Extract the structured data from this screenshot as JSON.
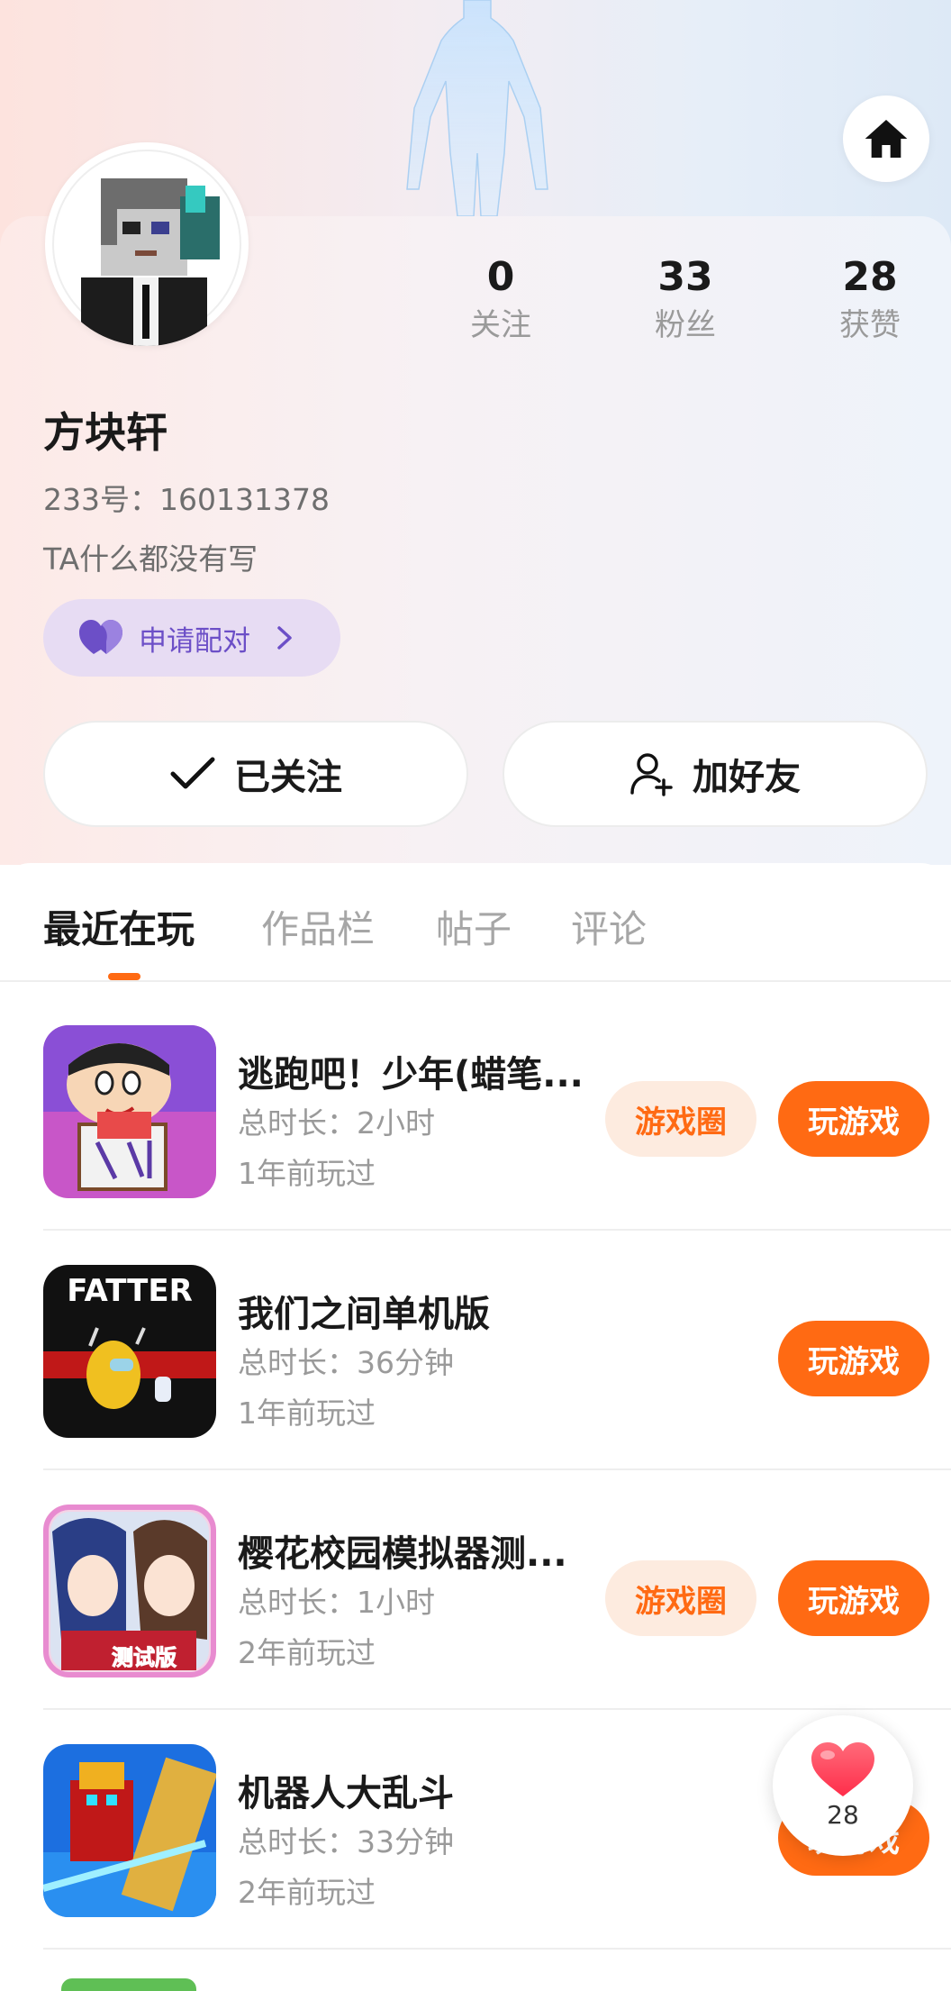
{
  "header": {
    "home_icon": "home-icon"
  },
  "profile": {
    "name": "方块轩",
    "id_text": "233号：160131378",
    "bio": "TA什么都没有写",
    "pair_label": "申请配对",
    "stats": [
      {
        "value": "0",
        "label": "关注"
      },
      {
        "value": "33",
        "label": "粉丝"
      },
      {
        "value": "28",
        "label": "获赞"
      }
    ]
  },
  "actions": {
    "follow_label": "已关注",
    "add_friend_label": "加好友"
  },
  "tabs": [
    {
      "label": "最近在玩",
      "active": true
    },
    {
      "label": "作品栏",
      "active": false
    },
    {
      "label": "帖子",
      "active": false
    },
    {
      "label": "评论",
      "active": false
    }
  ],
  "games": [
    {
      "title": "逃跑吧！少年(蜡笔...",
      "duration": "总时长：2小时",
      "last_played": "1年前玩过",
      "circle_label": "游戏圈",
      "play_label": "玩游戏"
    },
    {
      "title": "我们之间单机版",
      "duration": "总时长：36分钟",
      "last_played": "1年前玩过",
      "play_label": "玩游戏",
      "icon_text": "FATTER"
    },
    {
      "title": "樱花校园模拟器测...",
      "duration": "总时长：1小时",
      "last_played": "2年前玩过",
      "circle_label": "游戏圈",
      "play_label": "玩游戏",
      "icon_badge": "测试版"
    },
    {
      "title": "机器人大乱斗",
      "duration": "总时长：33分钟",
      "last_played": "2年前玩过",
      "play_label": "玩游戏"
    }
  ],
  "floating_like": {
    "count": "28"
  },
  "colors": {
    "accent": "#ff6a13",
    "pair_bg": "#e7dcf3",
    "pair_text": "#6c4fc7"
  }
}
